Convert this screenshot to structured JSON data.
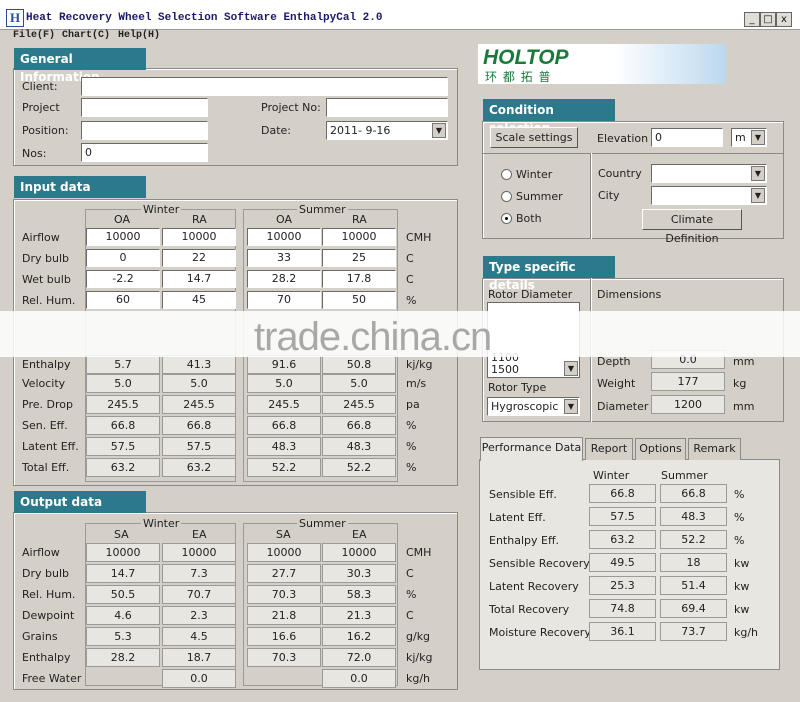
{
  "window": {
    "title": "Heat Recovery Wheel Selection Software EnthalpyCal 2.0",
    "logo_letter": "H",
    "controls": [
      "_",
      "□",
      "x"
    ]
  },
  "menu": [
    "File(F)",
    "Chart(C)",
    "Help(H)"
  ],
  "general": {
    "tab": "General Information",
    "client_label": "Client:",
    "client_value": "",
    "project_label": "Project",
    "project_value": "",
    "projectno_label": "Project No:",
    "projectno_value": "",
    "position_label": "Position:",
    "position_value": "",
    "date_label": "Date:",
    "date_value": "2011- 9-16",
    "nos_label": "Nos:",
    "nos_value": "0"
  },
  "brand": {
    "name": "HOLTOP",
    "sub": "环 都 拓 普",
    "color": "#1a7a3a"
  },
  "input": {
    "tab": "Input data",
    "winter": "Winter",
    "summer": "Summer",
    "cols": [
      "OA",
      "RA",
      "OA",
      "RA"
    ],
    "rows_top": [
      {
        "label": "Airflow",
        "vals": [
          "10000",
          "10000",
          "10000",
          "10000"
        ],
        "unit": "CMH"
      },
      {
        "label": "Dry bulb",
        "vals": [
          "0",
          "22",
          "33",
          "25"
        ],
        "unit": "C"
      },
      {
        "label": "Wet bulb",
        "vals": [
          "-2.2",
          "14.7",
          "28.2",
          "17.8"
        ],
        "unit": "C"
      },
      {
        "label": "Rel. Hum.",
        "vals": [
          "60",
          "45",
          "70",
          "50"
        ],
        "unit": "%"
      }
    ],
    "rows_partial": {
      "label": "Enthalpy",
      "vals": [
        "5.7",
        "41.3",
        "91.6",
        "50.8"
      ],
      "unit": "kj/kg"
    },
    "rows_bottom": [
      {
        "label": "Velocity",
        "vals": [
          "5.0",
          "5.0",
          "5.0",
          "5.0"
        ],
        "unit": "m/s"
      },
      {
        "label": "Pre. Drop",
        "vals": [
          "245.5",
          "245.5",
          "245.5",
          "245.5"
        ],
        "unit": "pa"
      },
      {
        "label": "Sen. Eff.",
        "vals": [
          "66.8",
          "66.8",
          "66.8",
          "66.8"
        ],
        "unit": "%"
      },
      {
        "label": "Latent Eff.",
        "vals": [
          "57.5",
          "57.5",
          "48.3",
          "48.3"
        ],
        "unit": "%"
      },
      {
        "label": "Total Eff.",
        "vals": [
          "63.2",
          "63.2",
          "52.2",
          "52.2"
        ],
        "unit": "%"
      }
    ]
  },
  "output": {
    "tab": "Output data",
    "winter": "Winter",
    "summer": "Summer",
    "cols": [
      "SA",
      "EA",
      "SA",
      "EA"
    ],
    "rows": [
      {
        "label": "Airflow",
        "vals": [
          "10000",
          "10000",
          "10000",
          "10000"
        ],
        "unit": "CMH"
      },
      {
        "label": "Dry bulb",
        "vals": [
          "14.7",
          "7.3",
          "27.7",
          "30.3"
        ],
        "unit": "C"
      },
      {
        "label": "Rel. Hum.",
        "vals": [
          "50.5",
          "70.7",
          "70.3",
          "58.3"
        ],
        "unit": "%"
      },
      {
        "label": "Dewpoint",
        "vals": [
          "4.6",
          "2.3",
          "21.8",
          "21.3"
        ],
        "unit": "C"
      },
      {
        "label": "Grains",
        "vals": [
          "5.3",
          "4.5",
          "16.6",
          "16.2"
        ],
        "unit": "g/kg"
      },
      {
        "label": "Enthalpy",
        "vals": [
          "28.2",
          "18.7",
          "70.3",
          "72.0"
        ],
        "unit": "kj/kg"
      },
      {
        "label": "Free Water",
        "vals": [
          "",
          "0.0",
          "",
          "0.0"
        ],
        "unit": "kg/h"
      }
    ]
  },
  "condition": {
    "tab": "Condition selection",
    "scale_btn": "Scale settings",
    "elevation_label": "Elevation",
    "elevation_value": "0",
    "elevation_unit": "m",
    "radios": [
      "Winter",
      "Summer",
      "Both"
    ],
    "selected": "Both",
    "country_label": "Country",
    "country_value": "",
    "city_label": "City",
    "city_value": "",
    "climate_btn": "Climate Definition"
  },
  "type": {
    "tab": "Type specific details",
    "rotor_diameter_label": "Rotor Diameter",
    "rotor_diameter_value": "1500",
    "rotor_list_item": "1100",
    "dimensions_label": "Dimensions",
    "depth_label": "Depth",
    "depth_value": "0.0",
    "depth_unit": "mm",
    "rotor_type_label": "Rotor Type",
    "rotor_type_value": "Hygroscopic",
    "weight_label": "Weight",
    "weight_value": "177",
    "weight_unit": "kg",
    "diameter_label": "Diameter",
    "diameter_value": "1200",
    "diameter_unit": "mm"
  },
  "perf": {
    "tabs": [
      "Performance Data",
      "Report",
      "Options",
      "Remark"
    ],
    "col_winter": "Winter",
    "col_summer": "Summer",
    "rows": [
      {
        "label": "Sensible Eff.",
        "w": "66.8",
        "s": "66.8",
        "unit": "%"
      },
      {
        "label": "Latent Eff.",
        "w": "57.5",
        "s": "48.3",
        "unit": "%"
      },
      {
        "label": "Enthalpy Eff.",
        "w": "63.2",
        "s": "52.2",
        "unit": "%"
      },
      {
        "label": "Sensible Recovery",
        "w": "49.5",
        "s": "18",
        "unit": "kw"
      },
      {
        "label": "Latent Recovery",
        "w": "25.3",
        "s": "51.4",
        "unit": "kw"
      },
      {
        "label": "Total Recovery",
        "w": "74.8",
        "s": "69.4",
        "unit": "kw"
      },
      {
        "label": "Moisture Recovery",
        "w": "36.1",
        "s": "73.7",
        "unit": "kg/h"
      }
    ]
  },
  "watermark": "trade.china.cn"
}
